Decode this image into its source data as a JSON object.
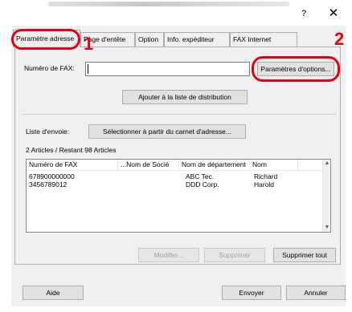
{
  "window": {
    "help_glyph": "?",
    "close_glyph": "✕"
  },
  "tabs": [
    {
      "label": "Paramètre adresse",
      "active": true
    },
    {
      "label": "Page d'entête"
    },
    {
      "label": "Option"
    },
    {
      "label": "Info. expéditeur"
    },
    {
      "label": "FAX Internet"
    }
  ],
  "fax_number": {
    "label": "Numéro de FAX:",
    "value": ""
  },
  "buttons": {
    "options": "Paramètres d'options...",
    "add_to_list": "Ajouter à la liste de distribution",
    "address_book": "Sélectionner à partir du carnet d'adresse...",
    "modify": "Modifier...",
    "delete": "Supprimer",
    "delete_all": "Supprimer tout",
    "help": "Aide",
    "send": "Envoyer",
    "cancel": "Annuler"
  },
  "send_list": {
    "label": "Liste d'envoie:",
    "summary": "2 Articles / Restant 98 Articles",
    "columns": [
      "Numéro de FAX",
      "...Nom de Socié",
      "Nom de département",
      "Nom"
    ],
    "rows": [
      {
        "fax": "678900000000",
        "company": "ABC Tec.",
        "name": "Richard"
      },
      {
        "fax": "3456789012",
        "company": "DDD Corp.",
        "name": "Harold"
      }
    ]
  },
  "annotations": [
    "1",
    "2"
  ],
  "colors": {
    "annotation_red": "#e60012",
    "dialog_bg": "#f0f0f0"
  }
}
